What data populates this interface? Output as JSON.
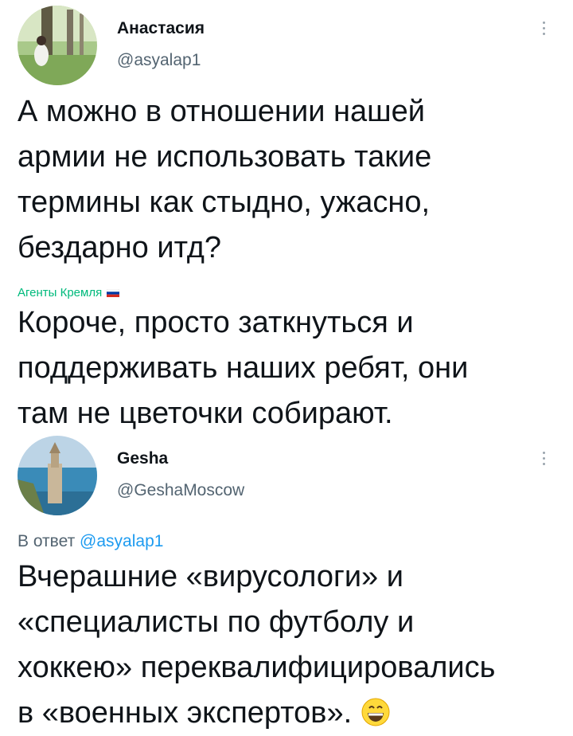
{
  "posts": [
    {
      "display_name": "Анастасия",
      "handle": "@asyalap1",
      "text": "А можно в отношении нашей\nармии не использовать такие\nтермины как стыдно, ужасно,\nбездарно итд?",
      "more_icon": "more-vertical-icon"
    },
    {
      "display_name": "Gesha",
      "handle": "@GeshaMoscow",
      "reply_prefix": "В ответ",
      "reply_to": "@asyalap1",
      "text": "Вчерашние «вирусологи» и\n«специалисты по футболу и\nхоккею» переквалифицировались\nв «военных экспертов».",
      "emoji": "grinning-face-icon",
      "more_icon": "more-vertical-icon"
    }
  ],
  "quoted": {
    "source": "Агенты Кремля",
    "flag_icon": "russia-flag-icon",
    "text": "Короче, просто заткнуться и\nподдерживать наших ребят, они\nтам не цветочки собирают."
  },
  "colors": {
    "text": "#0f1419",
    "secondary": "#536471",
    "link": "#1d9bf0",
    "quote_source": "#00ba7c"
  }
}
